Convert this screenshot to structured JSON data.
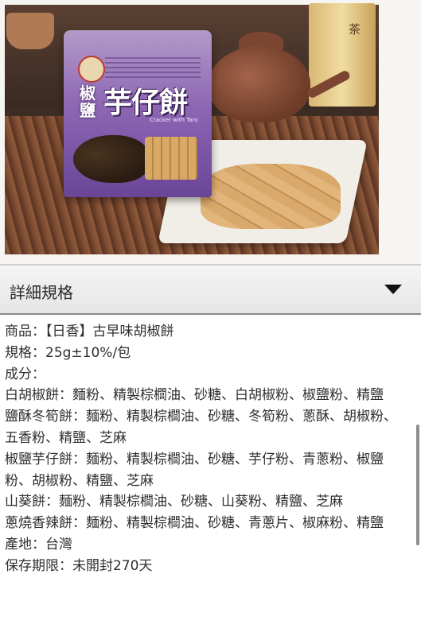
{
  "hero": {
    "bag_brand_small": "",
    "bag_title_side": "椒鹽",
    "bag_title_main": "芋仔餅",
    "bag_subtitle": "Cracker with Taro",
    "tea_tube_text": "茶"
  },
  "section": {
    "title": "詳細規格",
    "toggle_icon": "caret-down-icon"
  },
  "details": [
    "商品：【日香】古早味胡椒餅",
    "規格：25g±10%/包",
    "成分：",
    "白胡椒餅：麵粉、精製棕櫚油、砂糖、白胡椒粉、椒鹽粉、精鹽",
    "鹽酥冬筍餅：麵粉、精製棕櫚油、砂糖、冬筍粉、蔥酥、胡椒粉、五香粉、精鹽、芝麻",
    "椒鹽芋仔餅：麵粉、精製棕櫚油、砂糖、芋仔粉、青蔥粉、椒鹽粉、胡椒粉、精鹽、芝麻",
    "山葵餅：麵粉、精製棕櫚油、砂糖、山葵粉、精鹽、芝麻",
    "蔥燒香辣餅：麵粉、精製棕櫚油、砂糖、青蔥片、椒麻粉、精鹽",
    "產地：台灣",
    "保存期限：未開封270天"
  ]
}
